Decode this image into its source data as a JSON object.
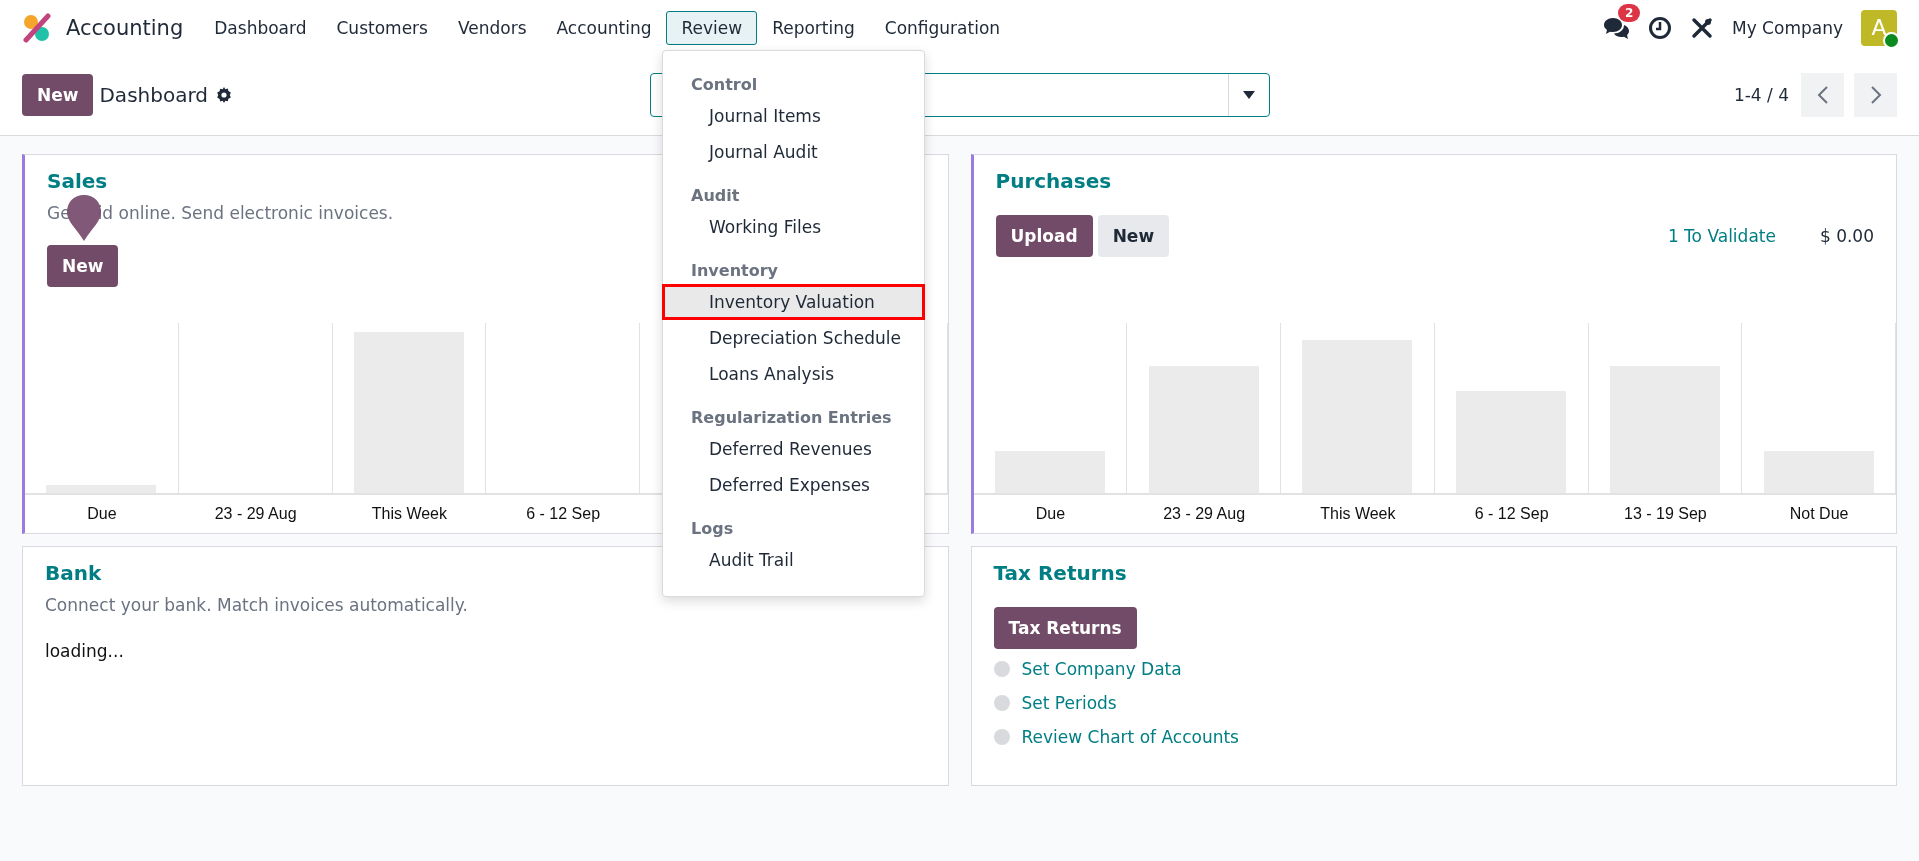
{
  "navbar": {
    "app": "Accounting",
    "menu": [
      {
        "label": "Dashboard",
        "selected": false
      },
      {
        "label": "Customers",
        "selected": false
      },
      {
        "label": "Vendors",
        "selected": false
      },
      {
        "label": "Accounting",
        "selected": false
      },
      {
        "label": "Review",
        "selected": true
      },
      {
        "label": "Reporting",
        "selected": false
      },
      {
        "label": "Configuration",
        "selected": false
      }
    ],
    "messages_badge": "2",
    "company": "My Company",
    "avatar": "A",
    "online": true
  },
  "control_panel": {
    "new_button": "New",
    "title": "Dashboard",
    "pager": "1-4 / 4"
  },
  "review_menu": {
    "sections": [
      {
        "header": "Control",
        "items": [
          {
            "label": "Journal Items",
            "highlighted": false
          },
          {
            "label": "Journal Audit",
            "highlighted": false
          }
        ]
      },
      {
        "header": "Audit",
        "items": [
          {
            "label": "Working Files",
            "highlighted": false
          }
        ]
      },
      {
        "header": "Inventory",
        "items": [
          {
            "label": "Inventory Valuation",
            "highlighted": true
          },
          {
            "label": "Depreciation Schedule",
            "highlighted": false
          },
          {
            "label": "Loans Analysis",
            "highlighted": false
          }
        ]
      },
      {
        "header": "Regularization Entries",
        "items": [
          {
            "label": "Deferred Revenues",
            "highlighted": false
          },
          {
            "label": "Deferred Expenses",
            "highlighted": false
          }
        ]
      },
      {
        "header": "Logs",
        "items": [
          {
            "label": "Audit Trail",
            "highlighted": false
          }
        ]
      }
    ]
  },
  "cards": [
    {
      "kind": "chart",
      "title": "Sales",
      "subtitle_parts": [
        "Ge",
        "id online. Send electronic invoices."
      ],
      "pin": true,
      "buttons": [
        {
          "label": "New",
          "primary": true
        }
      ],
      "categories": [
        "Due",
        "23 - 29 Aug",
        "This Week",
        "6 - 12 Sep"
      ]
    },
    {
      "kind": "chart",
      "title": "Purchases",
      "buttons": [
        {
          "label": "Upload",
          "primary": true
        },
        {
          "label": "New",
          "primary": false
        }
      ],
      "stat": {
        "label": "1 To Validate",
        "amount": "$ 0.00"
      },
      "categories": [
        "Due",
        "23 - 29 Aug",
        "This Week",
        "6 - 12 Sep",
        "13 - 19 Sep",
        "Not Due"
      ]
    },
    {
      "kind": "loading",
      "title": "Bank",
      "subtitle": "Connect your bank. Match invoices automatically.",
      "message": "loading..."
    },
    {
      "kind": "checklist",
      "title": "Tax Returns",
      "buttons": [
        {
          "label": "Tax Returns",
          "primary": true
        }
      ],
      "steps": [
        {
          "label": "Set Company Data",
          "done": false
        },
        {
          "label": "Set Periods",
          "done": false
        },
        {
          "label": "Review Chart of Accounts",
          "done": false
        }
      ]
    }
  ]
}
